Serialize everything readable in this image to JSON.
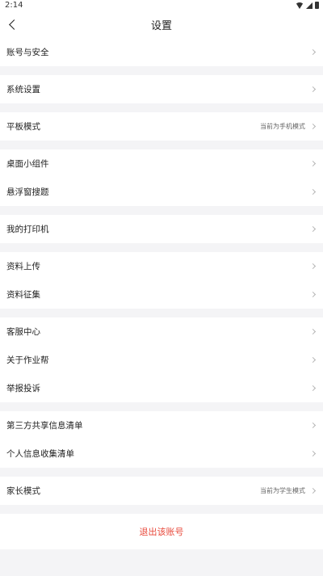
{
  "status_bar": {
    "time": "2:14"
  },
  "header": {
    "title": "设置"
  },
  "groups": [
    {
      "items": [
        {
          "label": "账号与安全"
        }
      ]
    },
    {
      "items": [
        {
          "label": "系统设置"
        }
      ]
    },
    {
      "items": [
        {
          "label": "平板模式",
          "value": "当前为手机模式"
        }
      ]
    },
    {
      "items": [
        {
          "label": "桌面小组件"
        },
        {
          "label": "悬浮窗搜题"
        }
      ]
    },
    {
      "items": [
        {
          "label": "我的打印机"
        }
      ]
    },
    {
      "items": [
        {
          "label": "资料上传"
        },
        {
          "label": "资料征集"
        }
      ]
    },
    {
      "items": [
        {
          "label": "客服中心"
        },
        {
          "label": "关于作业帮"
        },
        {
          "label": "举报投诉"
        }
      ]
    },
    {
      "items": [
        {
          "label": "第三方共享信息清单"
        },
        {
          "label": "个人信息收集清单"
        }
      ]
    },
    {
      "items": [
        {
          "label": "家长模式",
          "value": "当前为学生模式"
        }
      ]
    }
  ],
  "logout": {
    "label": "退出该账号"
  },
  "colors": {
    "background": "#f4f4f6",
    "logout": "#e84a3c"
  }
}
